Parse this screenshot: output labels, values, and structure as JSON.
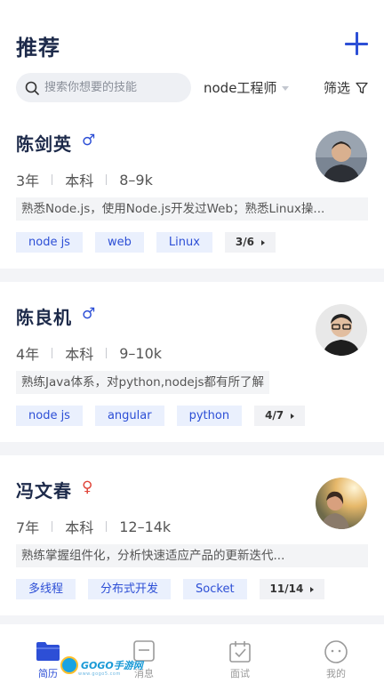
{
  "header": {
    "title": "推荐",
    "search_placeholder": "搜索你想要的技能",
    "job_filter": "node工程师",
    "filter_label": "筛选"
  },
  "candidates": [
    {
      "name": "陈剑英",
      "gender": "male",
      "gender_symbol": "♂",
      "experience": "3年",
      "education": "本科",
      "salary": "8–9k",
      "summary": "熟悉Node.js，使用Node.js开发过Web；熟悉Linux操...",
      "tags": [
        "node js",
        "web",
        "Linux"
      ],
      "tag_page": "3/6"
    },
    {
      "name": "陈良机",
      "gender": "male",
      "gender_symbol": "♂",
      "experience": "4年",
      "education": "本科",
      "salary": "9–10k",
      "summary": "熟练Java体系，对python,nodejs都有所了解",
      "tags": [
        "node js",
        "angular",
        "python"
      ],
      "tag_page": "4/7"
    },
    {
      "name": "冯文春",
      "gender": "female",
      "gender_symbol": "♀",
      "experience": "7年",
      "education": "本科",
      "salary": "12–14k",
      "summary": "熟练掌握组件化，分析快速适应产品的更新迭代...",
      "tags": [
        "多线程",
        "分布式开发",
        "Socket"
      ],
      "tag_page": "11/14"
    }
  ],
  "tabbar": {
    "items": [
      {
        "label": "简历",
        "icon": "folder-icon",
        "active": true
      },
      {
        "label": "消息",
        "icon": "message-icon",
        "active": false
      },
      {
        "label": "面试",
        "icon": "calendar-check-icon",
        "active": false
      },
      {
        "label": "我的",
        "icon": "profile-face-icon",
        "active": false
      }
    ]
  },
  "watermark": {
    "text": "GOGO手游网",
    "sub": "www.gogo5.com"
  },
  "colors": {
    "accent": "#2d4fd6",
    "title": "#1d2a4a",
    "female": "#e0453a",
    "tag_bg": "#eaf0fd"
  }
}
